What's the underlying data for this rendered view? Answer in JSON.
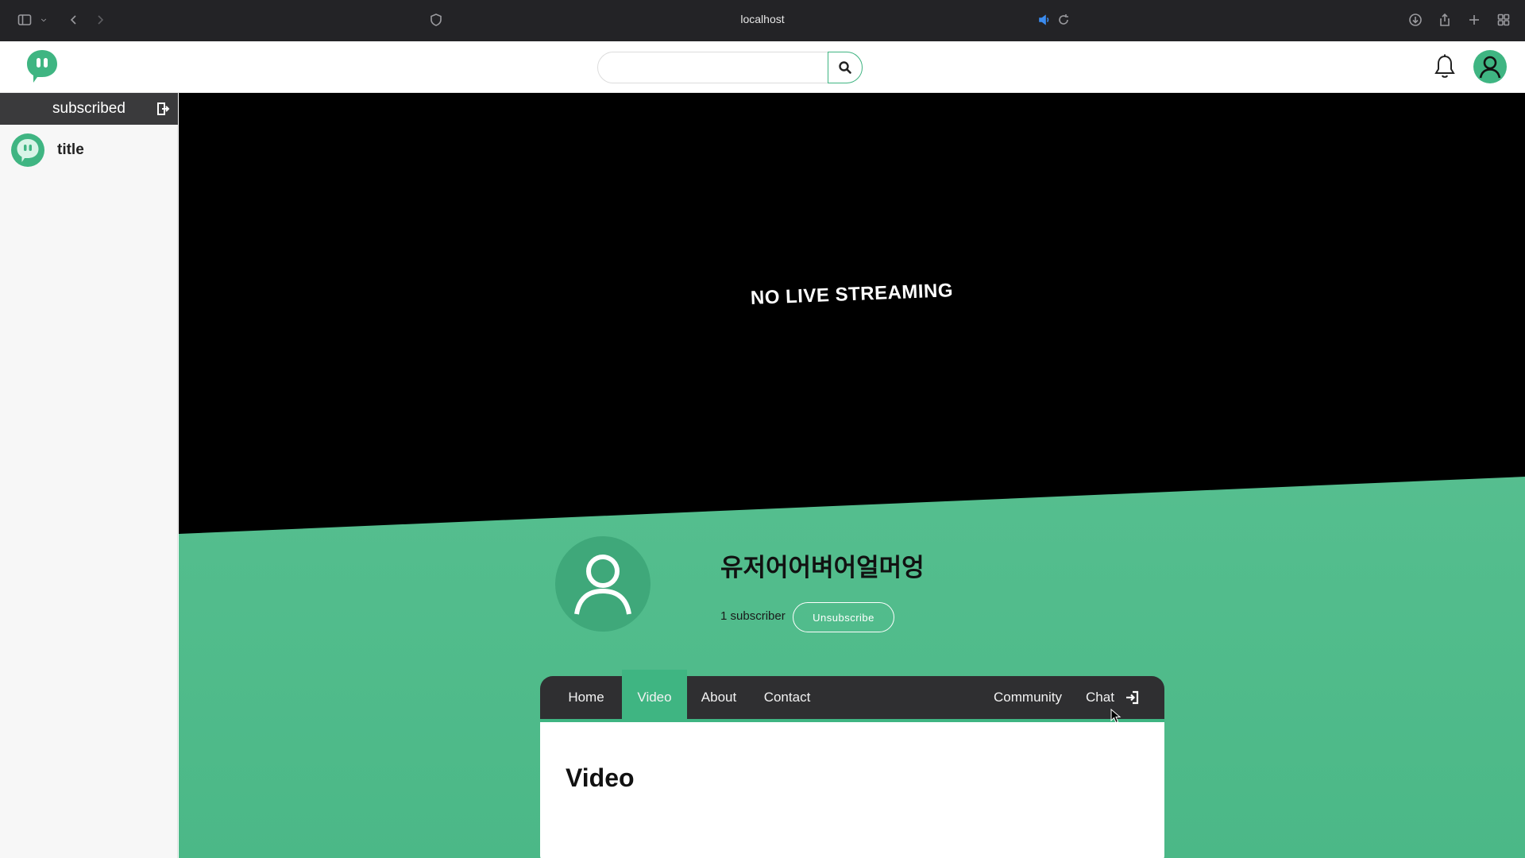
{
  "browser": {
    "url": "localhost",
    "icons": [
      "sidebar-icon",
      "chevron-down-icon",
      "back-icon",
      "forward-icon",
      "shield-icon",
      "audio-icon",
      "reload-icon",
      "download-icon",
      "share-icon",
      "new-tab-icon",
      "tab-overview-icon"
    ]
  },
  "header": {
    "search": {
      "placeholder": "",
      "value": ""
    },
    "icons": [
      "logo-icon",
      "search-icon",
      "bell-icon",
      "user-icon"
    ]
  },
  "sidebar": {
    "title": "subscribed",
    "items": [
      {
        "label": "title"
      }
    ]
  },
  "player": {
    "status": "NO LIVE STREAMING"
  },
  "channel": {
    "name": "유저어어벼어얼머엉",
    "subscribers": "1 subscriber",
    "unsubscribe_label": "Unsubscribe"
  },
  "nav": {
    "tabs": [
      {
        "label": "Home"
      },
      {
        "label": "Video",
        "active": true
      },
      {
        "label": "About"
      },
      {
        "label": "Contact"
      },
      {
        "label": "Community"
      },
      {
        "label": "Chat"
      }
    ]
  },
  "content": {
    "title": "Video"
  },
  "colors": {
    "accent": "#3fb582",
    "chrome": "#232326",
    "nav": "#2f2f31"
  }
}
